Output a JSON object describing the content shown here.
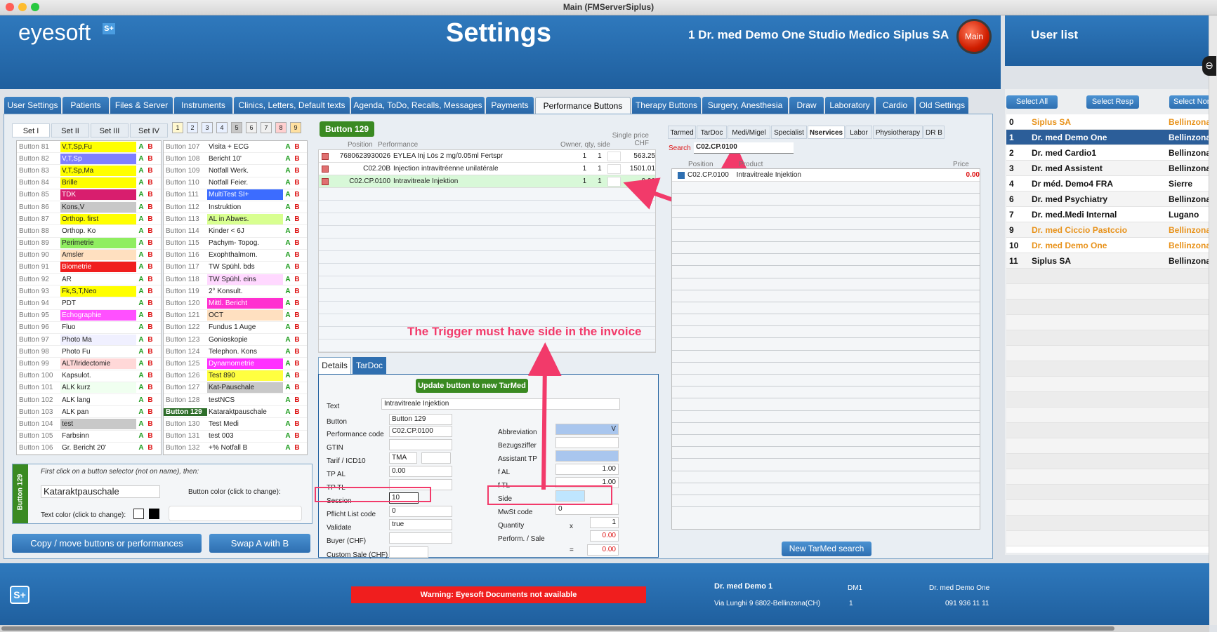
{
  "window": {
    "title": "Main (FMServerSiplus)"
  },
  "header": {
    "logo": "eyesoft",
    "logo_badge": "S+",
    "title": "Settings",
    "doctor": "1 Dr. med Demo One  Studio Medico Siplus SA",
    "main_button": "Main",
    "user_list_title": "User list"
  },
  "tabs": [
    {
      "label": "User Settings",
      "active": false
    },
    {
      "label": "Patients",
      "active": false
    },
    {
      "label": "Files & Server",
      "active": false
    },
    {
      "label": "Instruments",
      "active": false
    },
    {
      "label": "Clinics, Letters, Default texts",
      "active": false
    },
    {
      "label": "Agenda, ToDo, Recalls, Messages",
      "active": false
    },
    {
      "label": "Payments",
      "active": false
    },
    {
      "label": "Performance Buttons",
      "active": true
    },
    {
      "label": "Therapy Buttons",
      "active": false
    },
    {
      "label": "Surgery, Anesthesia",
      "active": false
    },
    {
      "label": "Draw",
      "active": false
    },
    {
      "label": "Laboratory",
      "active": false
    },
    {
      "label": "Cardio",
      "active": false
    },
    {
      "label": "Old Settings",
      "active": false
    }
  ],
  "sets": [
    "Set I",
    "Set II",
    "Set III",
    "Set IV"
  ],
  "set_numbers": [
    "1",
    "2",
    "3",
    "4",
    "5",
    "6",
    "7",
    "8",
    "9"
  ],
  "ab": {
    "a": "A",
    "b": "B"
  },
  "buttons_col1": [
    {
      "id": "Button 81",
      "name": "V,T,Sp,Fu",
      "color": "#ffff00"
    },
    {
      "id": "Button 82",
      "name": "V,T,Sp",
      "color": "#7f7fff"
    },
    {
      "id": "Button 83",
      "name": "V,T,Sp,Ma",
      "color": "#ffff00"
    },
    {
      "id": "Button 84",
      "name": "Brille",
      "color": "#ffff00"
    },
    {
      "id": "Button 85",
      "name": "TDK",
      "color": "#d81e6e"
    },
    {
      "id": "Button 86",
      "name": "Kons,V",
      "color": "#c8c8c8"
    },
    {
      "id": "Button 87",
      "name": "Orthop. first",
      "color": "#ffff00"
    },
    {
      "id": "Button 88",
      "name": "Orthop. Ko",
      "color": "#ffffff"
    },
    {
      "id": "Button 89",
      "name": "Perimetrie",
      "color": "#90ee60"
    },
    {
      "id": "Button 90",
      "name": "Amsler",
      "color": "#ffe0c0"
    },
    {
      "id": "Button 91",
      "name": "Biometrie",
      "color": "#f01e1e"
    },
    {
      "id": "Button 92",
      "name": "AR",
      "color": "#ffffff"
    },
    {
      "id": "Button 93",
      "name": "Fk,S,T,Neo",
      "color": "#ffff00"
    },
    {
      "id": "Button 94",
      "name": "PDT",
      "color": "#ffffff"
    },
    {
      "id": "Button 95",
      "name": "Echographie",
      "color": "#ff50ff"
    },
    {
      "id": "Button 96",
      "name": "Fluo",
      "color": "#ffffff"
    },
    {
      "id": "Button 97",
      "name": "Photo Ma",
      "color": "#f0f0ff"
    },
    {
      "id": "Button 98",
      "name": "Photo Fu",
      "color": "#ffffff"
    },
    {
      "id": "Button 99",
      "name": "ALT/Iridectomie",
      "color": "#ffd8d8"
    },
    {
      "id": "Button 100",
      "name": "Kapsulot.",
      "color": "#ffffff"
    },
    {
      "id": "Button 101",
      "name": "ALK kurz",
      "color": "#f0fff0"
    },
    {
      "id": "Button 102",
      "name": "ALK lang",
      "color": "#ffffff"
    },
    {
      "id": "Button 103",
      "name": "ALK pan",
      "color": "#ffffff"
    },
    {
      "id": "Button 104",
      "name": "test",
      "color": "#c8c8c8"
    },
    {
      "id": "Button 105",
      "name": "Farbsinn",
      "color": "#ffffff"
    },
    {
      "id": "Button 106",
      "name": "Gr. Bericht 20'",
      "color": "#ffffff"
    }
  ],
  "buttons_col2": [
    {
      "id": "Button 107",
      "name": "Visita + ECG",
      "color": "#ffffff"
    },
    {
      "id": "Button 108",
      "name": "Bericht 10'",
      "color": "#ffffff"
    },
    {
      "id": "Button 109",
      "name": "Notfall Werk.",
      "color": "#ffffff"
    },
    {
      "id": "Button 110",
      "name": "Notfall Feier.",
      "color": "#ffffff"
    },
    {
      "id": "Button 111",
      "name": "MultiTest SI+",
      "color": "#3c6cff"
    },
    {
      "id": "Button 112",
      "name": "Instruktion",
      "color": "#ffffff"
    },
    {
      "id": "Button 113",
      "name": "AL in Abwes.",
      "color": "#d8ff90"
    },
    {
      "id": "Button 114",
      "name": "Kinder < 6J",
      "color": "#ffffff"
    },
    {
      "id": "Button 115",
      "name": "Pachym- Topog.",
      "color": "#ffffff"
    },
    {
      "id": "Button 116",
      "name": "Exophthalmom.",
      "color": "#ffffff"
    },
    {
      "id": "Button 117",
      "name": "TW Spühl. bds",
      "color": "#ffffff"
    },
    {
      "id": "Button 118",
      "name": "TW Spühl. eins",
      "color": "#ffd8ff"
    },
    {
      "id": "Button 119",
      "name": "2° Konsult.",
      "color": "#ffffff"
    },
    {
      "id": "Button 120",
      "name": "Mittl. Bericht",
      "color": "#ff30d0"
    },
    {
      "id": "Button 121",
      "name": "OCT",
      "color": "#ffe0c0"
    },
    {
      "id": "Button 122",
      "name": "Fundus 1 Auge",
      "color": "#ffffff"
    },
    {
      "id": "Button 123",
      "name": "Gonioskopie",
      "color": "#ffffff"
    },
    {
      "id": "Button 124",
      "name": "Telephon. Kons",
      "color": "#ffffff"
    },
    {
      "id": "Button 125",
      "name": "Dynamometrie",
      "color": "#ff30ff"
    },
    {
      "id": "Button 126",
      "name": "Test 890",
      "color": "#ffff40"
    },
    {
      "id": "Button 127",
      "name": "Kat-Pauschale",
      "color": "#c8c8c8"
    },
    {
      "id": "Button 128",
      "name": "testNCS",
      "color": "#ffffff"
    },
    {
      "id": "Button 129",
      "name": "Kataraktpauschale",
      "color": "#ffffff",
      "selected": true
    },
    {
      "id": "Button 130",
      "name": "Test Medi",
      "color": "#ffffff"
    },
    {
      "id": "Button 131",
      "name": "test 003",
      "color": "#ffffff"
    },
    {
      "id": "Button 132",
      "name": "+% Notfall B",
      "color": "#ffffff"
    }
  ],
  "selector": {
    "vertical_label": "Button 129",
    "hint": "First click on a button selector (not on name), then:",
    "name_value": "Kataraktpauschale",
    "button_color_label": "Button color (click to change):",
    "text_color_label": "Text color (click to change):"
  },
  "bottom_buttons": {
    "copy": "Copy / move buttons or performances",
    "swap": "Swap A with B"
  },
  "perf": {
    "header_button": "Button 129",
    "col_position": "Position",
    "col_performance": "Performance",
    "col_owner": "Owner, qty, side",
    "col_price": "Single price CHF",
    "rows": [
      {
        "pos": "7680623930026",
        "perf": "EYLEA Inj Lös 2 mg/0.05ml Fertspr",
        "o": "1",
        "q": "1",
        "price": "563.25"
      },
      {
        "pos": "C02.20B",
        "perf": "Injection intravitréenne unilatérale",
        "o": "1",
        "q": "1",
        "price": "1501.01"
      },
      {
        "pos": "C02.CP.0100",
        "perf": "Intravitreale Injektion",
        "o": "1",
        "q": "1",
        "price": "0.00"
      }
    ]
  },
  "annotation": "The Trigger must have side in the invoice",
  "details": {
    "tab_details": "Details",
    "tab_tardoc": "TarDoc",
    "update_btn": "Update button to new TarMed",
    "text_label": "Text",
    "text_value": "Intravitreale Injektion",
    "button_label": "Button",
    "button_value": "Button 129",
    "perfcode_label": "Performance code",
    "perfcode_value": "C02.CP.0100",
    "gtin_label": "GTIN",
    "gtin_value": "",
    "tarif_label": "Tarif / ICD10",
    "tarif_value": "TMA",
    "tpal_label": "TP AL",
    "tpal_value": "0.00",
    "tptl_label": "TP TL",
    "tptl_value": "",
    "session_label": "Session",
    "session_value": "10",
    "pflicht_label": "Pflicht List code",
    "pflicht_value": "0",
    "validate_label": "Validate",
    "validate_value": "true",
    "buyer_label": "Buyer (CHF)",
    "buyer_value": "",
    "customsale_label": "Custom Sale (CHF)",
    "customsale_value": "",
    "abbr_label": "Abbreviation",
    "abbr_value": "V",
    "bezug_label": "Bezugsziffer",
    "bezug_value": "",
    "assistant_label": "Assistant TP",
    "assistant_value": "",
    "fal_label": "f AL",
    "fal_value": "1.00",
    "ftl_label": "f TL",
    "ftl_value": "1.00",
    "side_label": "Side",
    "side_value": "",
    "mwst_label": "MwSt code",
    "mwst_value": "0",
    "qty_label": "Quantity",
    "qty_value": "1",
    "perfsale_label": "Perform. / Sale",
    "perfsale_value": "0.00",
    "x_sign": "x",
    "eq_sign": "=",
    "total_value": "0.00"
  },
  "right": {
    "tabs": [
      "Tarmed",
      "TarDoc",
      "Medi/Migel",
      "Specialist",
      "Nservices",
      "Labor",
      "Physiotherapy",
      "DR B"
    ],
    "active_tab": "Nservices",
    "search_label": "Search",
    "search_value": "C02.CP.0100",
    "col_position": "Position",
    "col_product": "Product",
    "col_price": "Price",
    "result_pos": "C02.CP.0100",
    "result_product": "Intravitreale Injektion",
    "result_price": "0.00",
    "new_search": "New TarMed search"
  },
  "userlist": {
    "select_all": "Select All",
    "select_resp": "Select Resp",
    "select_none": "Select Non",
    "users": [
      {
        "n": "0",
        "name": "Siplus SA",
        "loc": "Bellinzona",
        "color": "#e8921a",
        "selected": false
      },
      {
        "n": "1",
        "name": "Dr. med Demo One",
        "loc": "Bellinzona",
        "color": "#ffffff",
        "selected": true
      },
      {
        "n": "2",
        "name": "Dr. med Cardio1",
        "loc": "Bellinzona",
        "color": "#111111",
        "selected": false
      },
      {
        "n": "3",
        "name": "Dr. med Assistent",
        "loc": "Bellinzona",
        "color": "#111111",
        "selected": false
      },
      {
        "n": "4",
        "name": "Dr méd. Demo4 FRA",
        "loc": "Sierre",
        "color": "#111111",
        "selected": false
      },
      {
        "n": "6",
        "name": "Dr. med Psychiatry",
        "loc": "Bellinzona",
        "color": "#111111",
        "selected": false
      },
      {
        "n": "7",
        "name": "Dr. med.Medi Internal",
        "loc": "Lugano",
        "color": "#111111",
        "selected": false
      },
      {
        "n": "9",
        "name": "Dr. med Ciccio Pastccio",
        "loc": "Bellinzona",
        "color": "#e8921a",
        "selected": false
      },
      {
        "n": "10",
        "name": "Dr. med Demo One",
        "loc": "Bellinzona",
        "color": "#e8921a",
        "selected": false
      },
      {
        "n": "11",
        "name": "Siplus SA",
        "loc": "Bellinzona",
        "color": "#111111",
        "selected": false
      }
    ]
  },
  "footer": {
    "warning": "Warning: Eyesoft Documents not available",
    "doc_name": "Dr. med Demo 1",
    "address": "Via Lunghi 9 6802-Bellinzona(CH)",
    "code": "DM1",
    "code2": "1",
    "doc2": "Dr. med Demo One",
    "phone": "091 936 11 11",
    "badge": "S+"
  }
}
